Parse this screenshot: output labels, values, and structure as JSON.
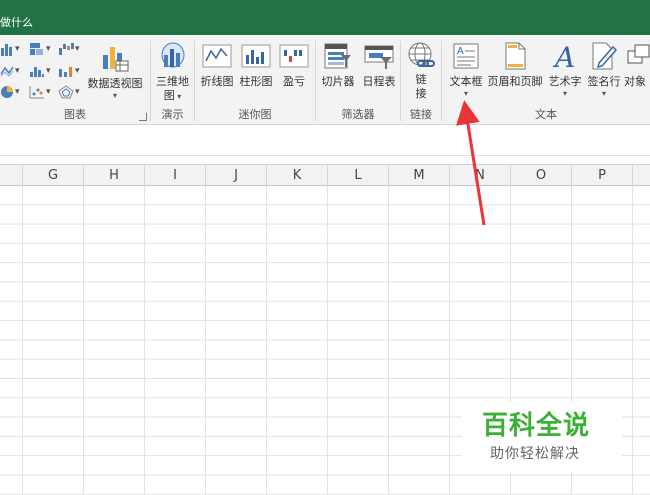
{
  "titlebar": {
    "tell_me": "做什么",
    "color": "#217346"
  },
  "ribbon": {
    "groups": {
      "charts": {
        "label": "图表",
        "pivot_chart": {
          "label": "数据透视图"
        }
      },
      "tours": {
        "label": "演示",
        "map3d": {
          "label_line1": "三维地",
          "label_line2": "图"
        }
      },
      "sparklines": {
        "label": "迷你图",
        "line": {
          "label": "折线图"
        },
        "column": {
          "label": "柱形图"
        },
        "winloss": {
          "label": "盈亏"
        }
      },
      "filters": {
        "label": "筛选器",
        "slicer": {
          "label": "切片器"
        },
        "timeline": {
          "label": "日程表"
        }
      },
      "links": {
        "label": "链接",
        "link": {
          "label_line1": "链",
          "label_line2": "接"
        }
      },
      "text": {
        "label": "文本",
        "textbox": {
          "label": "文本框"
        },
        "header_footer": {
          "label": "页眉和页脚"
        },
        "wordart": {
          "label": "艺术字"
        },
        "signature": {
          "label": "签名行"
        },
        "object": {
          "label": "对象"
        }
      }
    }
  },
  "columns": [
    "G",
    "H",
    "I",
    "J",
    "K",
    "L",
    "M",
    "N",
    "O",
    "P"
  ],
  "watermark": {
    "title": "百科全说",
    "subtitle": "助你轻松解决",
    "color": "#3cb034"
  },
  "annotation": {
    "color": "#e8353a"
  }
}
